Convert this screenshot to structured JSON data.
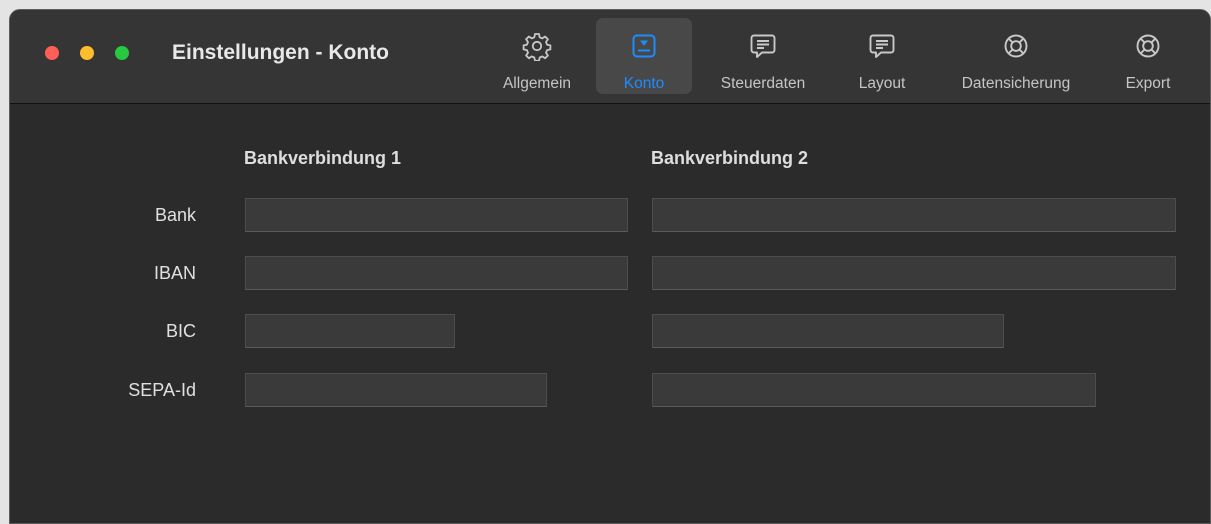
{
  "window": {
    "title": "Einstellungen - Konto"
  },
  "toolbar": {
    "items": [
      {
        "label": "Allgemein",
        "icon": "gear-icon",
        "active": false
      },
      {
        "label": "Konto",
        "icon": "account-card-icon",
        "active": true
      },
      {
        "label": "Steuerdaten",
        "icon": "speech-bubble-icon",
        "active": false
      },
      {
        "label": "Layout",
        "icon": "speech-bubble-icon",
        "active": false
      },
      {
        "label": "Datensicherung",
        "icon": "lifebuoy-icon",
        "active": false
      },
      {
        "label": "Export",
        "icon": "lifebuoy-icon",
        "active": false
      }
    ]
  },
  "form": {
    "column1_heading": "Bankverbindung 1",
    "column2_heading": "Bankverbindung 2",
    "rows": [
      {
        "label": "Bank",
        "value1": "",
        "value2": ""
      },
      {
        "label": "IBAN",
        "value1": "",
        "value2": ""
      },
      {
        "label": "BIC",
        "value1": "",
        "value2": ""
      },
      {
        "label": "SEPA-Id",
        "value1": "",
        "value2": ""
      }
    ]
  },
  "colors": {
    "window_background": "#2b2b2b",
    "titlebar_background": "#353535",
    "accent": "#1c8dff",
    "traffic_close": "#fe5f57",
    "traffic_minimize": "#febc2e",
    "traffic_zoom": "#28c840"
  }
}
